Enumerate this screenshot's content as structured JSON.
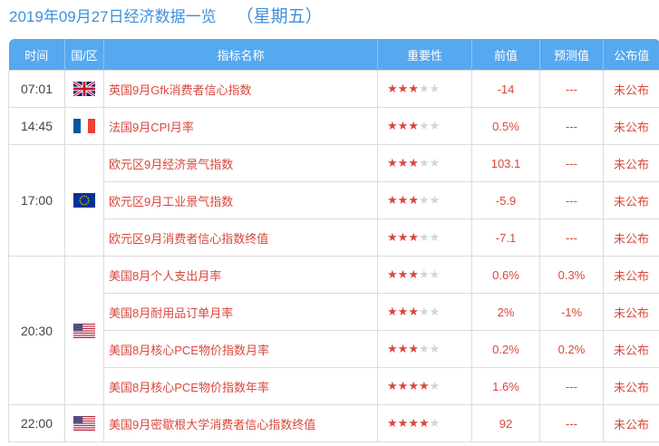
{
  "page": {
    "title": "2019年09月27日经济数据一览",
    "weekday": "（星期五）"
  },
  "table": {
    "headers": [
      "时间",
      "国/区",
      "指标名称",
      "重要性",
      "前值",
      "预测值",
      "公布值"
    ],
    "groups": [
      {
        "time": "07:01",
        "flag": "uk-flag-icon",
        "rows": [
          {
            "name": "英国9月Gfk消费者信心指数",
            "importance": 3,
            "previous": "-14",
            "forecast": "---",
            "actual": "未公布"
          }
        ]
      },
      {
        "time": "14:45",
        "flag": "france-flag-icon",
        "rows": [
          {
            "name": "法国9月CPI月率",
            "importance": 3,
            "previous": "0.5%",
            "forecast": "---",
            "actual": "未公布"
          }
        ]
      },
      {
        "time": "17:00",
        "flag": "eu-flag-icon",
        "rows": [
          {
            "name": "欧元区9月经济景气指数",
            "importance": 3,
            "previous": "103.1",
            "forecast": "---",
            "actual": "未公布"
          },
          {
            "name": "欧元区9月工业景气指数",
            "importance": 3,
            "previous": "-5.9",
            "forecast": "---",
            "actual": "未公布"
          },
          {
            "name": "欧元区9月消费者信心指数终值",
            "importance": 3,
            "previous": "-7.1",
            "forecast": "---",
            "actual": "未公布"
          }
        ]
      },
      {
        "time": "20:30",
        "flag": "us-flag-icon",
        "rows": [
          {
            "name": "美国8月个人支出月率",
            "importance": 3,
            "previous": "0.6%",
            "forecast": "0.3%",
            "actual": "未公布"
          },
          {
            "name": "美国8月耐用品订单月率",
            "importance": 3,
            "previous": "2%",
            "forecast": "-1%",
            "actual": "未公布"
          },
          {
            "name": "美国8月核心PCE物价指数月率",
            "importance": 3,
            "previous": "0.2%",
            "forecast": "0.2%",
            "actual": "未公布"
          },
          {
            "name": "美国8月核心PCE物价指数年率",
            "importance": 4,
            "previous": "1.6%",
            "forecast": "---",
            "actual": "未公布"
          }
        ]
      },
      {
        "time": "22:00",
        "flag": "us-flag-icon",
        "rows": [
          {
            "name": "美国9月密歇根大学消费者信心指数终值",
            "importance": 4,
            "previous": "92",
            "forecast": "---",
            "actual": "未公布"
          }
        ]
      }
    ],
    "importance_max": 5
  },
  "colors": {
    "accent": "#3f8fdc",
    "header_bg": "#56a8ef",
    "value_red": "#d9473c",
    "star_off": "#d5d5d5"
  }
}
